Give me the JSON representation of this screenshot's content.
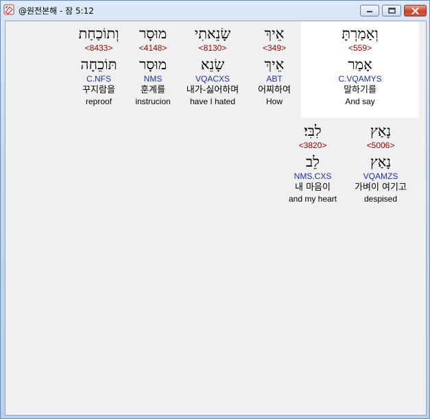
{
  "window": {
    "title": "@원전본해 - 잠 5:12",
    "app_icon": "bible-app-icon",
    "controls": {
      "minimize_icon": "minimize-icon",
      "maximize_icon": "maximize-icon",
      "close_icon": "close-icon"
    }
  },
  "colors": {
    "strong_number": "#a00000",
    "parsing": "#1b2fb5",
    "highlight_bg": "#ffffff"
  },
  "row1": [
    {
      "surface": "וְאָמַרְתָּ",
      "strong": "<559>",
      "lemma": "אָמַר",
      "parse": "C.VQAMYS",
      "korean": "말하기를",
      "english": "And say",
      "selected": true
    },
    {
      "surface": "אֵיךְ",
      "strong": "<349>",
      "lemma": "אֵיךְ",
      "parse": "ABT",
      "korean": "어찌하여",
      "english": "How",
      "selected": false
    },
    {
      "surface": "שָׂנֵאתִי",
      "strong": "<8130>",
      "lemma": "שָׂנֵא",
      "parse": "VQACXS",
      "korean": "내가-싫어하며",
      "english": "have I hated",
      "selected": false
    },
    {
      "surface": "מוּסָר",
      "strong": "<4148>",
      "lemma": "מוּסָר",
      "parse": "NMS",
      "korean": "훈계를",
      "english": "instrucion",
      "selected": false
    },
    {
      "surface": "וְתוֹכַחַת",
      "strong": "<8433>",
      "lemma": "תּוֹכֵחָה",
      "parse": "C.NFS",
      "korean": "꾸지람을",
      "english": "reproof",
      "selected": false
    }
  ],
  "row2": [
    {
      "surface": "נָאַץ",
      "strong": "<5006>",
      "lemma": "נָאַץ",
      "parse": "VQAMZS",
      "korean": "가벼이 여기고",
      "english": "despised",
      "selected": false
    },
    {
      "surface": "לִבִּי׃",
      "strong": "<3820>",
      "lemma": "לֵב",
      "parse": "NMS.CXS",
      "korean": "내 마음이",
      "english": "and my heart",
      "selected": false
    }
  ]
}
